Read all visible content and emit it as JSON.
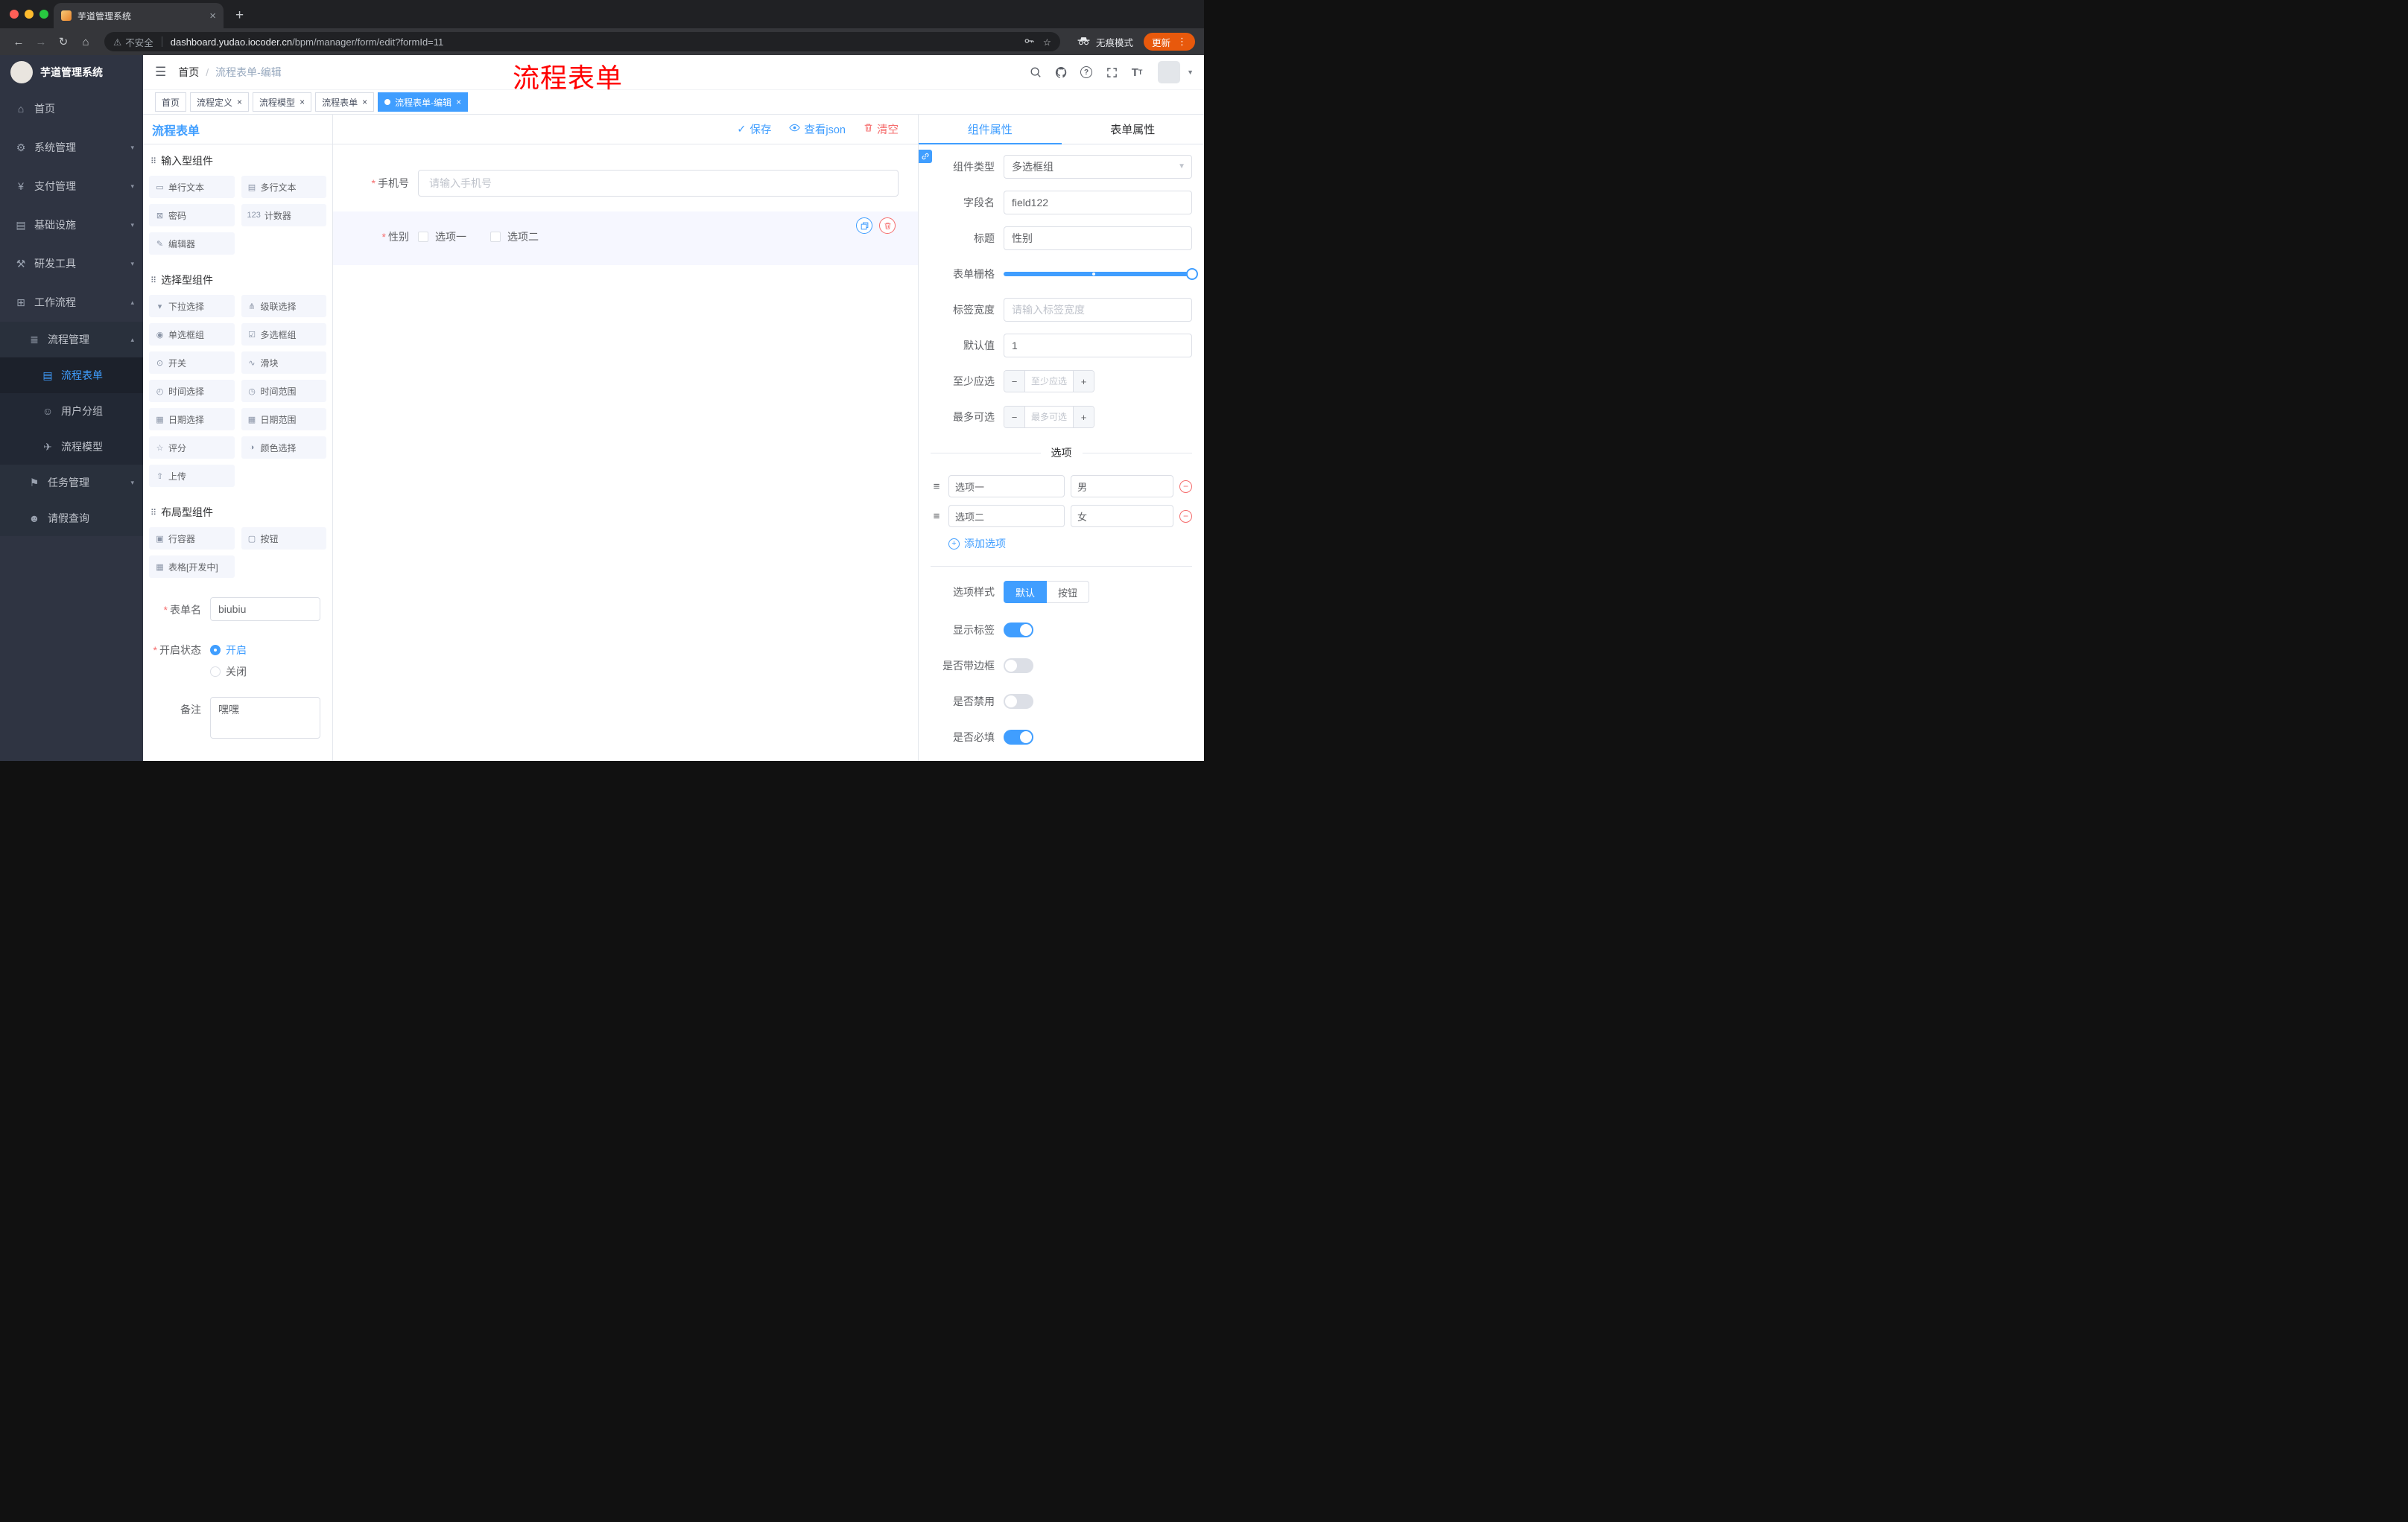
{
  "chrome": {
    "tab_title": "芋道管理系统",
    "security_label": "不安全",
    "url_domain": "dashboard.yudao.iocoder.cn",
    "url_path": "/bpm/manager/form/edit?formId=11",
    "incognito_label": "无痕模式",
    "update_label": "更新"
  },
  "annotation": "流程表单",
  "sidebar": {
    "logo_title": "芋道管理系统",
    "menu": [
      {
        "label": "首页",
        "icon": "⌂"
      },
      {
        "label": "系统管理",
        "icon": "⚙"
      },
      {
        "label": "支付管理",
        "icon": "¥"
      },
      {
        "label": "基础设施",
        "icon": "▤"
      },
      {
        "label": "研发工具",
        "icon": "⚒"
      },
      {
        "label": "工作流程",
        "icon": "⊞"
      }
    ],
    "workflow_children": [
      {
        "label": "流程管理",
        "icon": "≣"
      },
      {
        "label": "任务管理",
        "icon": "⚑"
      },
      {
        "label": "请假查询",
        "icon": "☻"
      }
    ],
    "process_children": [
      {
        "label": "流程表单",
        "icon": "▤"
      },
      {
        "label": "用户分组",
        "icon": "☺"
      },
      {
        "label": "流程模型",
        "icon": "✈"
      }
    ]
  },
  "header": {
    "breadcrumb_home": "首页",
    "breadcrumb_sep": "/",
    "breadcrumb_current": "流程表单-编辑"
  },
  "tags": [
    {
      "label": "首页"
    },
    {
      "label": "流程定义"
    },
    {
      "label": "流程模型"
    },
    {
      "label": "流程表单"
    },
    {
      "label": "流程表单-编辑"
    }
  ],
  "palette": {
    "panel_title": "流程表单",
    "groups": [
      {
        "title": "输入型组件"
      },
      {
        "title": "选择型组件"
      },
      {
        "title": "布局型组件"
      }
    ],
    "input_items": [
      {
        "label": "单行文本",
        "icon": "▭"
      },
      {
        "label": "多行文本",
        "icon": "▤"
      },
      {
        "label": "密码",
        "icon": "⊠"
      },
      {
        "label": "计数器",
        "icon": "123"
      },
      {
        "label": "编辑器",
        "icon": "✎"
      }
    ],
    "select_items": [
      {
        "label": "下拉选择",
        "icon": "▾"
      },
      {
        "label": "级联选择",
        "icon": "⋔"
      },
      {
        "label": "单选框组",
        "icon": "◉"
      },
      {
        "label": "多选框组",
        "icon": "☑"
      },
      {
        "label": "开关",
        "icon": "⊙"
      },
      {
        "label": "滑块",
        "icon": "∿"
      },
      {
        "label": "时间选择",
        "icon": "◴"
      },
      {
        "label": "时间范围",
        "icon": "◷"
      },
      {
        "label": "日期选择",
        "icon": "▦"
      },
      {
        "label": "日期范围",
        "icon": "▦"
      },
      {
        "label": "评分",
        "icon": "☆"
      },
      {
        "label": "颜色选择",
        "icon": "◑"
      },
      {
        "label": "上传",
        "icon": "⇧"
      }
    ],
    "layout_items": [
      {
        "label": "行容器",
        "icon": "▣"
      },
      {
        "label": "按钮",
        "icon": "▢"
      },
      {
        "label": "表格[开发中]",
        "icon": "▦"
      }
    ],
    "meta": {
      "name_label": "表单名",
      "name_value": "biubiu",
      "status_label": "开启状态",
      "status_on": "开启",
      "status_off": "关闭",
      "remark_label": "备注",
      "remark_value": "嘿嘿"
    }
  },
  "canvas": {
    "save": "保存",
    "view_json": "查看json",
    "clear": "清空",
    "phone_label": "手机号",
    "phone_placeholder": "请输入手机号",
    "gender_label": "性别",
    "gender_opt1": "选项一",
    "gender_opt2": "选项二"
  },
  "inspector": {
    "tab_component": "组件属性",
    "tab_form": "表单属性",
    "rows": {
      "type_label": "组件类型",
      "type_value": "多选框组",
      "field_label": "字段名",
      "field_value": "field122",
      "title_label": "标题",
      "title_value": "性别",
      "grid_label": "表单栅格",
      "width_label": "标签宽度",
      "width_placeholder": "请输入标签宽度",
      "default_label": "默认值",
      "default_value": "1",
      "min_label": "至少应选",
      "min_placeholder": "至少应选",
      "max_label": "最多可选",
      "max_placeholder": "最多可选"
    },
    "options_title": "选项",
    "options": [
      {
        "label": "选项一",
        "value": "男"
      },
      {
        "label": "选项二",
        "value": "女"
      }
    ],
    "add_option": "添加选项",
    "style_label": "选项样式",
    "style_default": "默认",
    "style_button": "按钮",
    "switch_rows": [
      {
        "label": "显示标签",
        "state": "on"
      },
      {
        "label": "是否带边框",
        "state": "off"
      },
      {
        "label": "是否禁用",
        "state": "off"
      },
      {
        "label": "是否必填",
        "state": "on"
      }
    ]
  },
  "colors": {
    "accent": "#409eff",
    "danger": "#f56c6c",
    "sidebar_bg": "#2f3442",
    "update_badge": "#e8590c"
  }
}
